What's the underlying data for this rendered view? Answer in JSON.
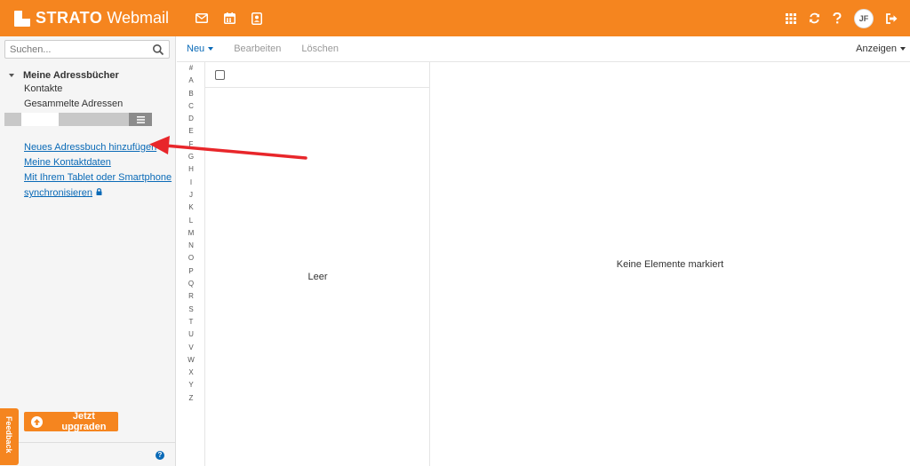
{
  "app": {
    "brand": "STRATO",
    "product": "Webmail",
    "user_initials": "JF"
  },
  "header": {
    "apps": [
      "mail-icon",
      "calendar-icon",
      "contacts-icon"
    ],
    "actions": [
      "apps-grid-icon",
      "refresh-icon",
      "help-icon",
      "logout-icon"
    ]
  },
  "sidebar": {
    "search_placeholder": "Suchen...",
    "tree_title": "Meine Adressbücher",
    "items": [
      "Kontakte",
      "Gesammelte Adressen"
    ],
    "links": {
      "add_addressbook": "Neues Adressbuch hinzufügen",
      "my_contact": "Meine Kontaktdaten",
      "sync_line1": "Mit Ihrem Tablet oder Smartphone",
      "sync_line2": "synchronisieren"
    },
    "upgrade_label": "Jetzt upgraden",
    "feedback_label": "Feedback",
    "collapse_label": "«"
  },
  "toolbar": {
    "new_label": "Neu",
    "edit_label": "Bearbeiten",
    "delete_label": "Löschen",
    "view_label": "Anzeigen"
  },
  "alphabet": [
    "#",
    "A",
    "B",
    "C",
    "D",
    "E",
    "F",
    "G",
    "H",
    "I",
    "J",
    "K",
    "L",
    "M",
    "N",
    "O",
    "P",
    "Q",
    "R",
    "S",
    "T",
    "U",
    "V",
    "W",
    "X",
    "Y",
    "Z"
  ],
  "list": {
    "empty_label": "Leer"
  },
  "detail": {
    "empty_label": "Keine Elemente markiert"
  },
  "colors": {
    "brand_orange": "#f5851f",
    "link_blue": "#0a6ab7",
    "annotation_red": "#e8262a"
  }
}
